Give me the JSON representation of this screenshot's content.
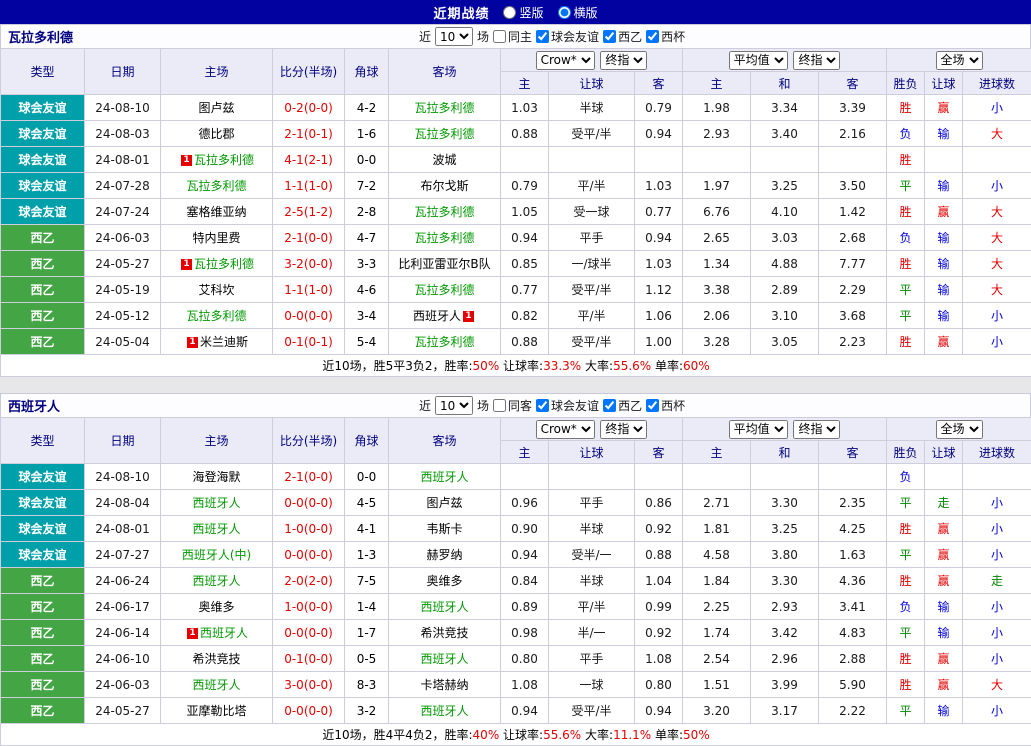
{
  "topbar": {
    "title": "近期战绩",
    "layout_options": [
      {
        "label": "竖版",
        "selected": false
      },
      {
        "label": "横版",
        "selected": true
      }
    ]
  },
  "filter_shared": {
    "prefix": "近",
    "count": "10",
    "suffix": "场"
  },
  "columns": {
    "static": [
      "类型",
      "日期",
      "主场",
      "比分(半场)",
      "角球",
      "客场"
    ],
    "dropdowns": {
      "asia_source": "Crow*",
      "asia_type": "终指",
      "euro_source": "平均值",
      "euro_type": "终指",
      "scope": "全场"
    },
    "sub": [
      "主",
      "让球",
      "客",
      "主",
      "和",
      "客",
      "胜负",
      "让球",
      "进球数"
    ]
  },
  "result_colors": {
    "胜": "#e60000",
    "平": "#008800",
    "负": "#0000dd",
    "赢": "#e60000",
    "走": "#008800",
    "输": "#0000dd",
    "大": "#e60000",
    "小": "#0000dd"
  },
  "type_colors": {
    "球会友谊": "#00a0aa",
    "西乙": "#44a544"
  },
  "sections": [
    {
      "team": "瓦拉多利德",
      "filter_checkboxes": [
        {
          "label": "同主",
          "checked": false
        },
        {
          "label": "球会友谊",
          "checked": true
        },
        {
          "label": "西乙",
          "checked": true
        },
        {
          "label": "西杯",
          "checked": true
        }
      ],
      "rows": [
        {
          "type": "球会友谊",
          "date": "24-08-10",
          "home": {
            "name": "图卢兹"
          },
          "score": "0-2(0-0)",
          "corner": "4-2",
          "away": {
            "name": "瓦拉多利德",
            "focus": true
          },
          "asia": [
            "1.03",
            "半球",
            "0.79"
          ],
          "euro": [
            "1.98",
            "3.34",
            "3.39"
          ],
          "result": "胜",
          "handicap": "赢",
          "goals": "小"
        },
        {
          "type": "球会友谊",
          "date": "24-08-03",
          "home": {
            "name": "德比郡"
          },
          "score": "2-1(0-1)",
          "corner": "1-6",
          "away": {
            "name": "瓦拉多利德",
            "focus": true
          },
          "asia": [
            "0.88",
            "受平/半",
            "0.94"
          ],
          "euro": [
            "2.93",
            "3.40",
            "2.16"
          ],
          "result": "负",
          "handicap": "输",
          "goals": "大"
        },
        {
          "type": "球会友谊",
          "date": "24-08-01",
          "home": {
            "name": "瓦拉多利德",
            "focus": true,
            "badge": "1",
            "badge_pos": "before"
          },
          "score": "4-1(2-1)",
          "corner": "0-0",
          "away": {
            "name": "波城"
          },
          "asia": [
            "",
            "",
            ""
          ],
          "euro": [
            "",
            "",
            ""
          ],
          "result": "胜",
          "handicap": "",
          "goals": ""
        },
        {
          "type": "球会友谊",
          "date": "24-07-28",
          "home": {
            "name": "瓦拉多利德",
            "focus": true
          },
          "score": "1-1(1-0)",
          "corner": "7-2",
          "away": {
            "name": "布尔戈斯"
          },
          "asia": [
            "0.79",
            "平/半",
            "1.03"
          ],
          "euro": [
            "1.97",
            "3.25",
            "3.50"
          ],
          "result": "平",
          "handicap": "输",
          "goals": "小"
        },
        {
          "type": "球会友谊",
          "date": "24-07-24",
          "home": {
            "name": "塞格维亚纳"
          },
          "score": "2-5(1-2)",
          "corner": "2-8",
          "away": {
            "name": "瓦拉多利德",
            "focus": true
          },
          "asia": [
            "1.05",
            "受一球",
            "0.77"
          ],
          "euro": [
            "6.76",
            "4.10",
            "1.42"
          ],
          "result": "胜",
          "handicap": "赢",
          "goals": "大"
        },
        {
          "type": "西乙",
          "date": "24-06-03",
          "home": {
            "name": "特内里费"
          },
          "score": "2-1(0-0)",
          "corner": "4-7",
          "away": {
            "name": "瓦拉多利德",
            "focus": true
          },
          "asia": [
            "0.94",
            "平手",
            "0.94"
          ],
          "euro": [
            "2.65",
            "3.03",
            "2.68"
          ],
          "result": "负",
          "handicap": "输",
          "goals": "大"
        },
        {
          "type": "西乙",
          "date": "24-05-27",
          "home": {
            "name": "瓦拉多利德",
            "focus": true,
            "badge": "1",
            "badge_pos": "before"
          },
          "score": "3-2(0-0)",
          "corner": "3-3",
          "away": {
            "name": "比利亚雷亚尔B队"
          },
          "asia": [
            "0.85",
            "一/球半",
            "1.03"
          ],
          "euro": [
            "1.34",
            "4.88",
            "7.77"
          ],
          "result": "胜",
          "handicap": "输",
          "goals": "大"
        },
        {
          "type": "西乙",
          "date": "24-05-19",
          "home": {
            "name": "艾科坎"
          },
          "score": "1-1(1-0)",
          "corner": "4-6",
          "away": {
            "name": "瓦拉多利德",
            "focus": true
          },
          "asia": [
            "0.77",
            "受平/半",
            "1.12"
          ],
          "euro": [
            "3.38",
            "2.89",
            "2.29"
          ],
          "result": "平",
          "handicap": "输",
          "goals": "大"
        },
        {
          "type": "西乙",
          "date": "24-05-12",
          "home": {
            "name": "瓦拉多利德",
            "focus": true
          },
          "score": "0-0(0-0)",
          "corner": "3-4",
          "away": {
            "name": "西班牙人",
            "badge": "1",
            "badge_pos": "after"
          },
          "asia": [
            "0.82",
            "平/半",
            "1.06"
          ],
          "euro": [
            "2.06",
            "3.10",
            "3.68"
          ],
          "result": "平",
          "handicap": "输",
          "goals": "小"
        },
        {
          "type": "西乙",
          "date": "24-05-04",
          "home": {
            "name": "米兰迪斯",
            "badge": "1",
            "badge_pos": "before"
          },
          "score": "0-1(0-1)",
          "corner": "5-4",
          "away": {
            "name": "瓦拉多利德",
            "focus": true
          },
          "asia": [
            "0.88",
            "受平/半",
            "1.00"
          ],
          "euro": [
            "3.28",
            "3.05",
            "2.23"
          ],
          "result": "胜",
          "handicap": "赢",
          "goals": "小"
        }
      ],
      "summary": [
        {
          "text": "近10场，胜5平3负2，胜率:",
          "highlight": false
        },
        {
          "text": "50%",
          "highlight": true
        },
        {
          "text": " 让球率:",
          "highlight": false
        },
        {
          "text": "33.3%",
          "highlight": true
        },
        {
          "text": " 大率:",
          "highlight": false
        },
        {
          "text": "55.6%",
          "highlight": true
        },
        {
          "text": " 单率:",
          "highlight": false
        },
        {
          "text": "60%",
          "highlight": true
        }
      ]
    },
    {
      "team": "西班牙人",
      "filter_checkboxes": [
        {
          "label": "同客",
          "checked": false
        },
        {
          "label": "球会友谊",
          "checked": true
        },
        {
          "label": "西乙",
          "checked": true
        },
        {
          "label": "西杯",
          "checked": true
        }
      ],
      "rows": [
        {
          "type": "球会友谊",
          "date": "24-08-10",
          "home": {
            "name": "海登海默"
          },
          "score": "2-1(0-0)",
          "corner": "0-0",
          "away": {
            "name": "西班牙人",
            "focus": true
          },
          "asia": [
            "",
            "",
            ""
          ],
          "euro": [
            "",
            "",
            ""
          ],
          "result": "负",
          "handicap": "",
          "goals": ""
        },
        {
          "type": "球会友谊",
          "date": "24-08-04",
          "home": {
            "name": "西班牙人",
            "focus": true
          },
          "score": "0-0(0-0)",
          "corner": "4-5",
          "away": {
            "name": "图卢兹"
          },
          "asia": [
            "0.96",
            "平手",
            "0.86"
          ],
          "euro": [
            "2.71",
            "3.30",
            "2.35"
          ],
          "result": "平",
          "handicap": "走",
          "goals": "小"
        },
        {
          "type": "球会友谊",
          "date": "24-08-01",
          "home": {
            "name": "西班牙人",
            "focus": true
          },
          "score": "1-0(0-0)",
          "corner": "4-1",
          "away": {
            "name": "韦斯卡"
          },
          "asia": [
            "0.90",
            "半球",
            "0.92"
          ],
          "euro": [
            "1.81",
            "3.25",
            "4.25"
          ],
          "result": "胜",
          "handicap": "赢",
          "goals": "小"
        },
        {
          "type": "球会友谊",
          "date": "24-07-27",
          "home": {
            "name": "西班牙人(中)",
            "focus": true
          },
          "score": "0-0(0-0)",
          "corner": "1-3",
          "away": {
            "name": "赫罗纳"
          },
          "asia": [
            "0.94",
            "受半/一",
            "0.88"
          ],
          "euro": [
            "4.58",
            "3.80",
            "1.63"
          ],
          "result": "平",
          "handicap": "赢",
          "goals": "小"
        },
        {
          "type": "西乙",
          "date": "24-06-24",
          "home": {
            "name": "西班牙人",
            "focus": true
          },
          "score": "2-0(2-0)",
          "corner": "7-5",
          "away": {
            "name": "奥维多"
          },
          "asia": [
            "0.84",
            "半球",
            "1.04"
          ],
          "euro": [
            "1.84",
            "3.30",
            "4.36"
          ],
          "result": "胜",
          "handicap": "赢",
          "goals": "走"
        },
        {
          "type": "西乙",
          "date": "24-06-17",
          "home": {
            "name": "奥维多"
          },
          "score": "1-0(0-0)",
          "corner": "1-4",
          "away": {
            "name": "西班牙人",
            "focus": true
          },
          "asia": [
            "0.89",
            "平/半",
            "0.99"
          ],
          "euro": [
            "2.25",
            "2.93",
            "3.41"
          ],
          "result": "负",
          "handicap": "输",
          "goals": "小"
        },
        {
          "type": "西乙",
          "date": "24-06-14",
          "home": {
            "name": "西班牙人",
            "focus": true,
            "badge": "1",
            "badge_pos": "before"
          },
          "score": "0-0(0-0)",
          "corner": "1-7",
          "away": {
            "name": "希洪竞技"
          },
          "asia": [
            "0.98",
            "半/一",
            "0.92"
          ],
          "euro": [
            "1.74",
            "3.42",
            "4.83"
          ],
          "result": "平",
          "handicap": "输",
          "goals": "小"
        },
        {
          "type": "西乙",
          "date": "24-06-10",
          "home": {
            "name": "希洪竞技"
          },
          "score": "0-1(0-0)",
          "corner": "0-5",
          "away": {
            "name": "西班牙人",
            "focus": true
          },
          "asia": [
            "0.80",
            "平手",
            "1.08"
          ],
          "euro": [
            "2.54",
            "2.96",
            "2.88"
          ],
          "result": "胜",
          "handicap": "赢",
          "goals": "小"
        },
        {
          "type": "西乙",
          "date": "24-06-03",
          "home": {
            "name": "西班牙人",
            "focus": true
          },
          "score": "3-0(0-0)",
          "corner": "8-3",
          "away": {
            "name": "卡塔赫纳"
          },
          "asia": [
            "1.08",
            "一球",
            "0.80"
          ],
          "euro": [
            "1.51",
            "3.99",
            "5.90"
          ],
          "result": "胜",
          "handicap": "赢",
          "goals": "大"
        },
        {
          "type": "西乙",
          "date": "24-05-27",
          "home": {
            "name": "亚摩勒比塔"
          },
          "score": "0-0(0-0)",
          "corner": "3-2",
          "away": {
            "name": "西班牙人",
            "focus": true
          },
          "asia": [
            "0.94",
            "受平/半",
            "0.94"
          ],
          "euro": [
            "3.20",
            "3.17",
            "2.22"
          ],
          "result": "平",
          "handicap": "输",
          "goals": "小"
        }
      ],
      "summary": [
        {
          "text": "近10场，胜4平4负2，胜率:",
          "highlight": false
        },
        {
          "text": "40%",
          "highlight": true
        },
        {
          "text": " 让球率:",
          "highlight": false
        },
        {
          "text": "55.6%",
          "highlight": true
        },
        {
          "text": " 大率:",
          "highlight": false
        },
        {
          "text": "11.1%",
          "highlight": true
        },
        {
          "text": " 单率:",
          "highlight": false
        },
        {
          "text": "50%",
          "highlight": true
        }
      ]
    }
  ]
}
